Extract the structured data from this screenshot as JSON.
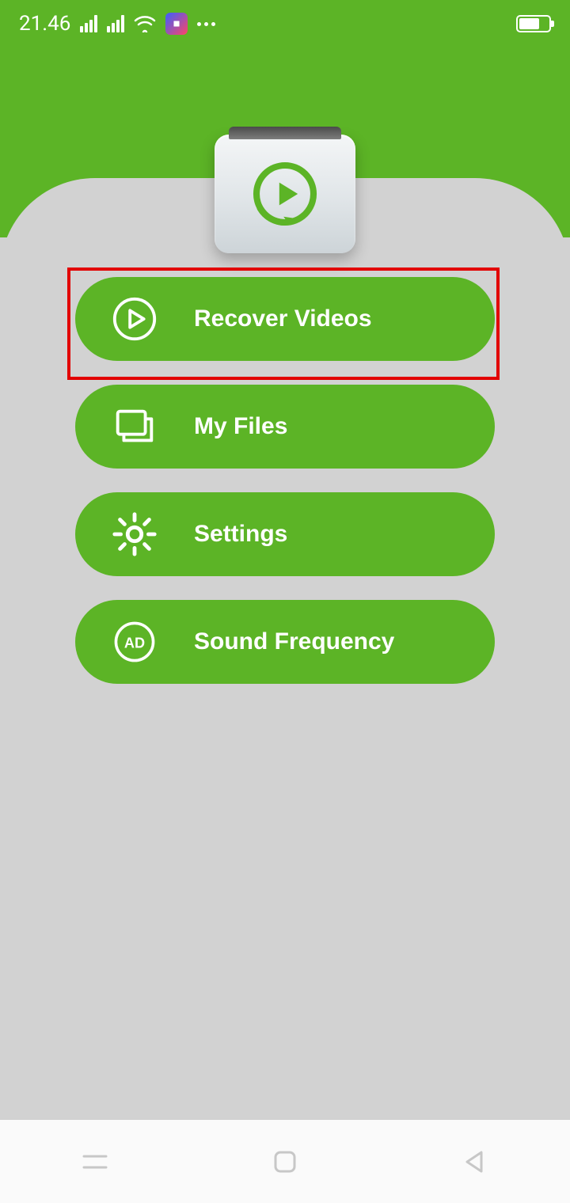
{
  "status": {
    "time": "21.46"
  },
  "menu": {
    "recover": {
      "label": "Recover Videos"
    },
    "files": {
      "label": "My Files"
    },
    "settings": {
      "label": "Settings"
    },
    "sound": {
      "label": "Sound Frequency",
      "badge": "AD"
    }
  },
  "colors": {
    "primary": "#5cb426",
    "panel": "#d2d2d2",
    "highlight": "#e20000"
  }
}
